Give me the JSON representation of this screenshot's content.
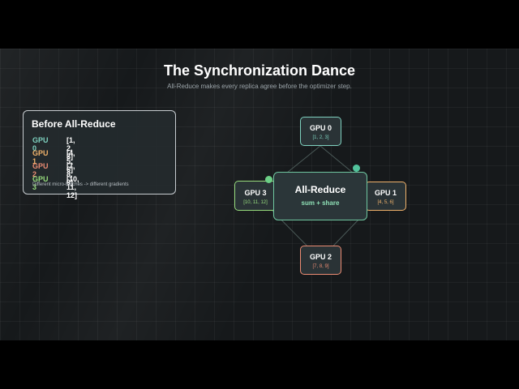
{
  "title": "The Synchronization Dance",
  "subtitle": "All-Reduce makes every replica agree before the optimizer step.",
  "before_panel": {
    "title": "Before All-Reduce",
    "rows": [
      {
        "gpu": "GPU 0",
        "values": "[1, 2, 3]",
        "color": "#7ed1bf"
      },
      {
        "gpu": "GPU 1",
        "values": "[4, 5, 6]",
        "color": "#f0b26b"
      },
      {
        "gpu": "GPU 2",
        "values": "[7, 8, 9]",
        "color": "#ec8c73"
      },
      {
        "gpu": "GPU 3",
        "values": "[10, 11, 12]",
        "color": "#97dc7d"
      }
    ],
    "note": "Different micro-batches -> different gradients"
  },
  "diagram": {
    "center": {
      "title": "All-Reduce",
      "subtitle": "sum + share",
      "color": "#6fc7a0"
    },
    "nodes": [
      {
        "name": "GPU 0",
        "values": "[1, 2, 3]",
        "color": "#7ed1bf"
      },
      {
        "name": "GPU 1",
        "values": "[4, 5, 6]",
        "color": "#f0b26b"
      },
      {
        "name": "GPU 2",
        "values": "[7, 8, 9]",
        "color": "#ec8c73"
      },
      {
        "name": "GPU 3",
        "values": "[10, 11, 12]",
        "color": "#97dc7d"
      }
    ]
  }
}
